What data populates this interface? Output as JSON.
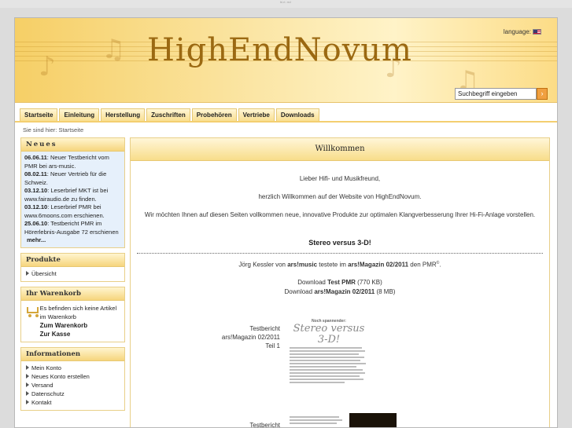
{
  "window": {
    "strip_text": "hi.ri. rrd"
  },
  "header": {
    "logo": "HighEndNovum",
    "language_label": "language:",
    "search_placeholder": "Suchbegriff eingeben",
    "search_go": "›"
  },
  "nav": {
    "tabs": [
      "Startseite",
      "Einleitung",
      "Herstellung",
      "Zuschriften",
      "Probehören",
      "Vertriebe",
      "Downloads"
    ]
  },
  "breadcrumb": "Sie sind hier: Startseite",
  "sidebar": {
    "news": {
      "title": "Neues",
      "items": [
        {
          "date": "06.06.11",
          "text": ": Neuer Testbericht vom PMR bei ars-music."
        },
        {
          "date": "08.02.11",
          "text": ": Neuer Vertrieb für die Schweiz."
        },
        {
          "date": "03.12.10",
          "text": ": Leserbrief MKT ist bei www.fairaudio.de zu finden."
        },
        {
          "date": "03.12.10",
          "text": ": Leserbrief PMR bei www.6moons.com erschienen."
        },
        {
          "date": "25.06.10",
          "text": ": Testbericht PMR im Hörerlebnis-Ausgabe 72 erschienen"
        }
      ],
      "more": "mehr..."
    },
    "products": {
      "title": "Produkte",
      "items": [
        "Übersicht"
      ]
    },
    "cart": {
      "title": "Ihr Warenkorb",
      "text": "Es befinden sich keine Artikel im Warenkorb",
      "to_cart": "Zum Warenkorb",
      "checkout": "Zur Kasse"
    },
    "info": {
      "title": "Informationen",
      "items": [
        "Mein Konto",
        "Neues Konto erstellen",
        "Versand",
        "Datenschutz",
        "Kontakt"
      ]
    }
  },
  "main": {
    "title": "Willkommen",
    "greeting": "Lieber Hifi- und Musikfreund,",
    "welcome": "herzlich Willkommen auf der Website von HighEndNovum.",
    "intro": "Wir möchten Ihnen auf diesen Seiten vollkommen neue, innovative Produkte zur optimalen Klangverbesserung Ihrer Hi-Fi-Anlage vorstellen.",
    "section_title": "Stereo versus 3-D!",
    "test_pre": "Jörg Kessler von ",
    "test_mag1": "ars!music",
    "test_mid": " testete im ",
    "test_mag2": "ars!Magazin 02/2011",
    "test_post": " den PMR",
    "test_sup": "©",
    "test_end": ".",
    "dl1_pre": "Download ",
    "dl1_bold": "Test PMR",
    "dl1_size": " (770 KB)",
    "dl2_pre": "Download ",
    "dl2_bold": "ars!Magazin 02/2011",
    "dl2_size": " (8 MB)",
    "report1": [
      "Testbericht",
      "ars!Magazin 02/2011",
      "Teil 1"
    ],
    "report2_label": "Testbericht",
    "thumb1_kicker": "Noch spannender:",
    "thumb1_title": "Stereo versus 3-D!"
  }
}
